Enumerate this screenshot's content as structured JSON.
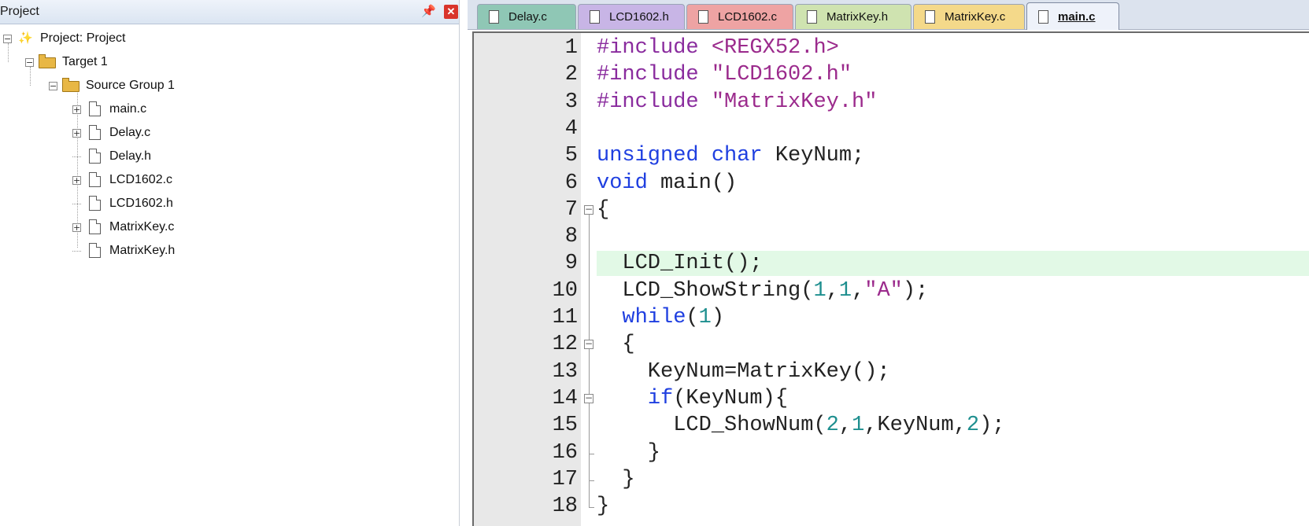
{
  "project_panel": {
    "title": "Project",
    "pin_icon": "pin-icon",
    "close_icon": "close-icon",
    "tree": {
      "project_label": "Project: Project",
      "target_label": "Target 1",
      "group_label": "Source Group 1",
      "files": [
        {
          "name": "main.c",
          "expandable": true
        },
        {
          "name": "Delay.c",
          "expandable": true
        },
        {
          "name": "Delay.h",
          "expandable": false
        },
        {
          "name": "LCD1602.c",
          "expandable": true
        },
        {
          "name": "LCD1602.h",
          "expandable": false
        },
        {
          "name": "MatrixKey.c",
          "expandable": true
        },
        {
          "name": "MatrixKey.h",
          "expandable": false
        }
      ]
    }
  },
  "editor": {
    "tabs": [
      {
        "label": "Delay.c",
        "color": "#8fc7b5",
        "active": false
      },
      {
        "label": "LCD1602.h",
        "color": "#c8b5e6",
        "active": false
      },
      {
        "label": "LCD1602.c",
        "color": "#eea3a3",
        "active": false
      },
      {
        "label": "MatrixKey.h",
        "color": "#cfe3b0",
        "active": false
      },
      {
        "label": "MatrixKey.c",
        "color": "#f4d98a",
        "active": false
      },
      {
        "label": "main.c",
        "color": "#dde6f5",
        "active": true
      }
    ],
    "current_line": 9,
    "colors": {
      "keyword": "#1f3fe0",
      "preprocessor": "#8a2c9e",
      "string": "#9b2a8c",
      "number": "#1e8f8f",
      "current_line_bg": "#e2f9e6"
    },
    "lines": [
      {
        "n": "1",
        "tokens": [
          {
            "t": "#include ",
            "c": "pp"
          },
          {
            "t": "<REGX52.h>",
            "c": "str"
          }
        ]
      },
      {
        "n": "2",
        "tokens": [
          {
            "t": "#include ",
            "c": "pp"
          },
          {
            "t": "\"LCD1602.h\"",
            "c": "str"
          }
        ]
      },
      {
        "n": "3",
        "tokens": [
          {
            "t": "#include ",
            "c": "pp"
          },
          {
            "t": "\"MatrixKey.h\"",
            "c": "str"
          }
        ]
      },
      {
        "n": "4",
        "tokens": []
      },
      {
        "n": "5",
        "tokens": [
          {
            "t": "unsigned",
            "c": "kw"
          },
          {
            "t": " ",
            "c": ""
          },
          {
            "t": "char",
            "c": "kw"
          },
          {
            "t": " KeyNum;",
            "c": ""
          }
        ]
      },
      {
        "n": "6",
        "tokens": [
          {
            "t": "void",
            "c": "kw"
          },
          {
            "t": " main()",
            "c": ""
          }
        ]
      },
      {
        "n": "7",
        "tokens": [
          {
            "t": "{",
            "c": ""
          }
        ]
      },
      {
        "n": "8",
        "tokens": []
      },
      {
        "n": "9",
        "tokens": [
          {
            "t": "  LCD_Init();",
            "c": ""
          }
        ]
      },
      {
        "n": "10",
        "tokens": [
          {
            "t": "  LCD_ShowString(",
            "c": ""
          },
          {
            "t": "1",
            "c": "num"
          },
          {
            "t": ",",
            "c": ""
          },
          {
            "t": "1",
            "c": "num"
          },
          {
            "t": ",",
            "c": ""
          },
          {
            "t": "\"A\"",
            "c": "str"
          },
          {
            "t": ");",
            "c": ""
          }
        ]
      },
      {
        "n": "11",
        "tokens": [
          {
            "t": "  ",
            "c": ""
          },
          {
            "t": "while",
            "c": "kw"
          },
          {
            "t": "(",
            "c": ""
          },
          {
            "t": "1",
            "c": "num"
          },
          {
            "t": ")",
            "c": ""
          }
        ]
      },
      {
        "n": "12",
        "tokens": [
          {
            "t": "  {",
            "c": ""
          }
        ]
      },
      {
        "n": "13",
        "tokens": [
          {
            "t": "    KeyNum=MatrixKey();",
            "c": ""
          }
        ]
      },
      {
        "n": "14",
        "tokens": [
          {
            "t": "    ",
            "c": ""
          },
          {
            "t": "if",
            "c": "kw"
          },
          {
            "t": "(KeyNum){",
            "c": ""
          }
        ]
      },
      {
        "n": "15",
        "tokens": [
          {
            "t": "      LCD_ShowNum(",
            "c": ""
          },
          {
            "t": "2",
            "c": "num"
          },
          {
            "t": ",",
            "c": ""
          },
          {
            "t": "1",
            "c": "num"
          },
          {
            "t": ",KeyNum,",
            "c": ""
          },
          {
            "t": "2",
            "c": "num"
          },
          {
            "t": ");",
            "c": ""
          }
        ]
      },
      {
        "n": "16",
        "tokens": [
          {
            "t": "    }",
            "c": ""
          }
        ]
      },
      {
        "n": "17",
        "tokens": [
          {
            "t": "  }",
            "c": ""
          }
        ]
      },
      {
        "n": "18",
        "tokens": [
          {
            "t": "}",
            "c": ""
          }
        ]
      }
    ]
  }
}
